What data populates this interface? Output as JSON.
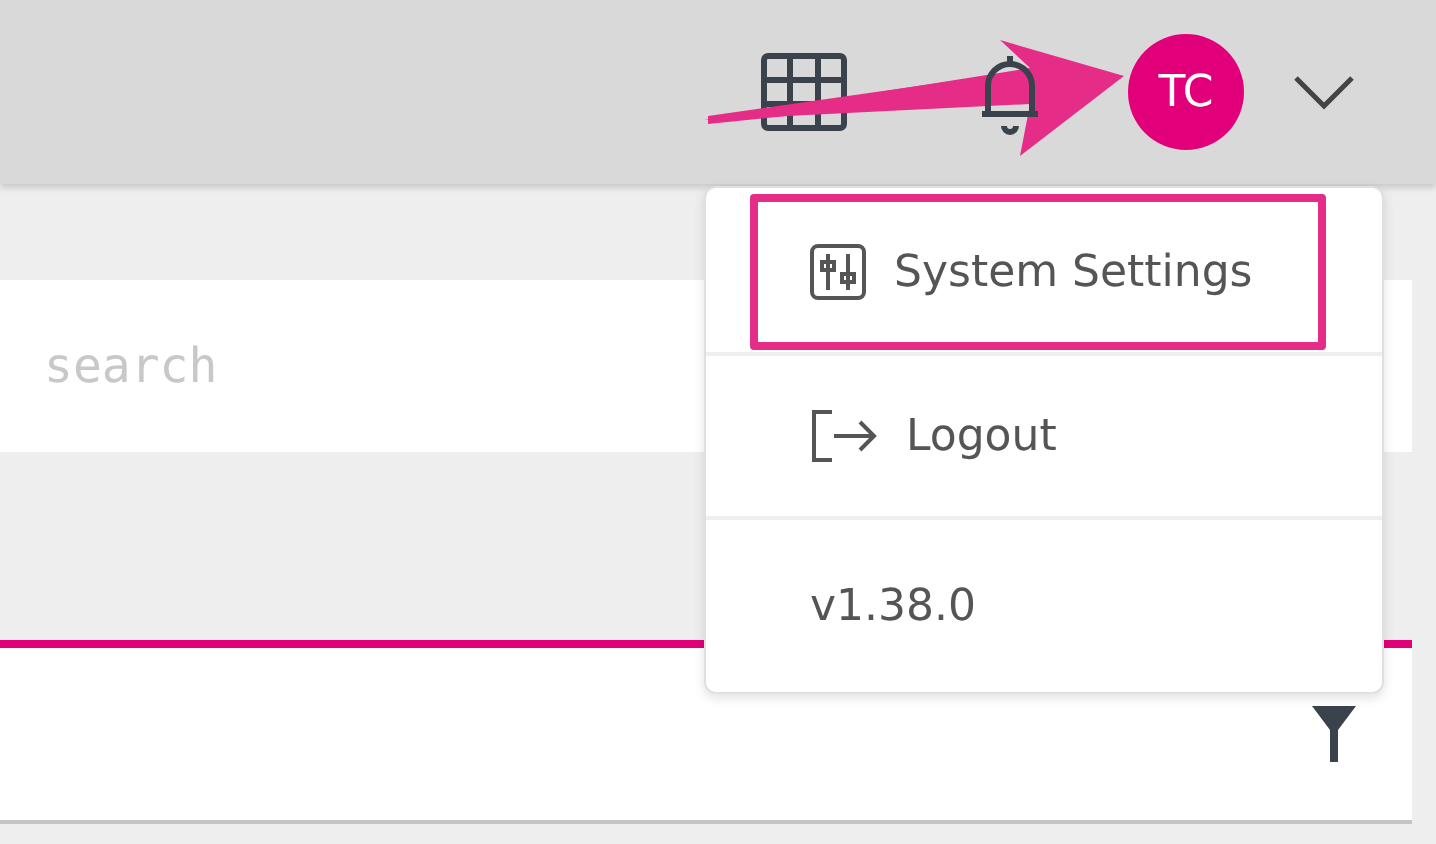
{
  "header": {
    "avatar": {
      "initials": "TC"
    }
  },
  "search": {
    "placeholder": "search"
  },
  "user_menu": {
    "items": [
      {
        "kind": "settings",
        "label": "System Settings",
        "highlighted": true
      },
      {
        "kind": "logout",
        "label": "Logout",
        "highlighted": false
      },
      {
        "kind": "version",
        "label": "v1.38.0",
        "highlighted": false
      }
    ]
  }
}
